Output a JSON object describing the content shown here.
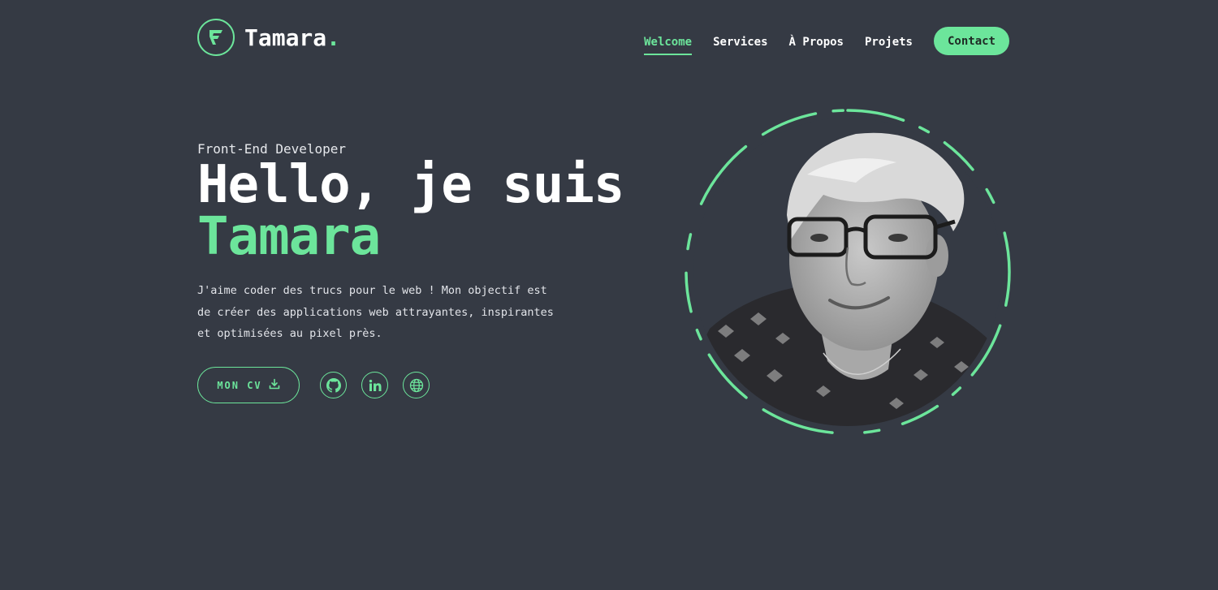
{
  "brand": {
    "name": "Tamara",
    "dot": ".",
    "accent_color": "#6ce59b",
    "background_color": "#353a44",
    "logo_icon": "tamara-logo-icon"
  },
  "nav": {
    "items": [
      {
        "label": "Welcome",
        "active": true
      },
      {
        "label": "Services",
        "active": false
      },
      {
        "label": "À Propos",
        "active": false
      },
      {
        "label": "Projets",
        "active": false
      }
    ],
    "contact_label": "Contact"
  },
  "hero": {
    "subtitle": "Front-End Developer",
    "headline": "Hello, je suis",
    "name": "Tamara",
    "description": "J'aime coder des trucs pour le web ! Mon objectif est de créer des applications web attrayantes, inspirantes et optimisées au pixel près.",
    "cv_label": "MON CV",
    "cv_icon": "download-icon",
    "socials": [
      {
        "icon": "github-icon"
      },
      {
        "icon": "linkedin-icon"
      },
      {
        "icon": "globe-icon"
      }
    ],
    "portrait_icon": "portrait-photo"
  }
}
